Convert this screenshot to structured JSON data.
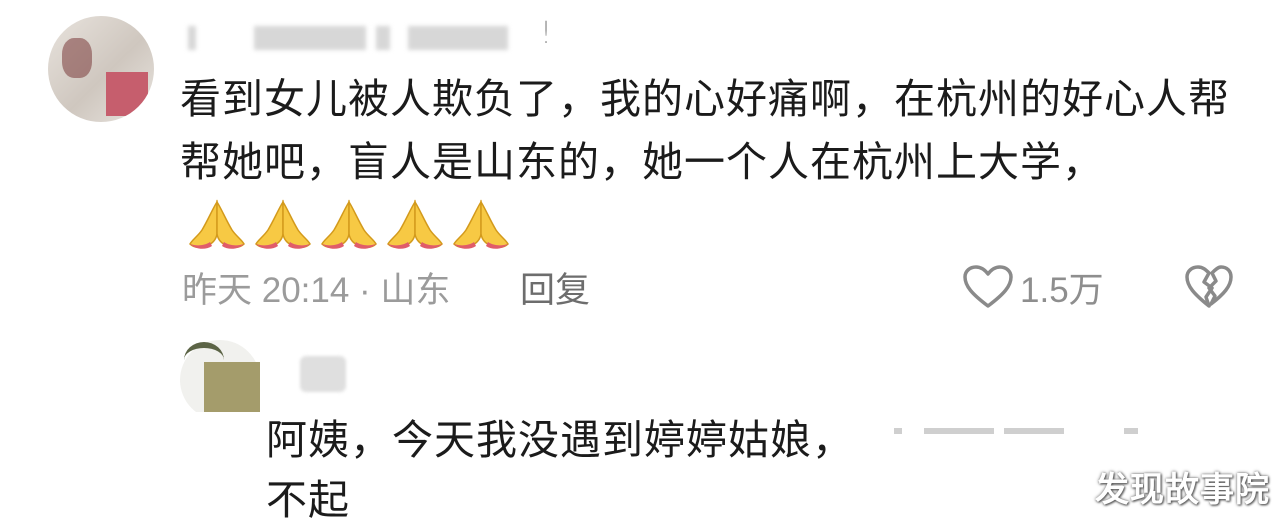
{
  "comment": {
    "text": "看到女儿被人欺负了，我的心好痛啊，在杭州的好心人帮帮她吧，盲人是山东的，她一个人在杭州上大学，",
    "emoji": "folded-hands",
    "emoji_count": 5,
    "name_suffix": "!",
    "meta": "昨天 20:14 · 山东",
    "reply_label": "回复",
    "likes": "1.5万"
  },
  "reply": {
    "text_line1": "阿姨，今天我没遇到婷婷姑娘，",
    "text_line2": "不起"
  },
  "watermark": "发现故事院",
  "colors": {
    "text": "#1b1b1b",
    "meta": "#9b9b9b",
    "icon": "#8a8a8a"
  }
}
